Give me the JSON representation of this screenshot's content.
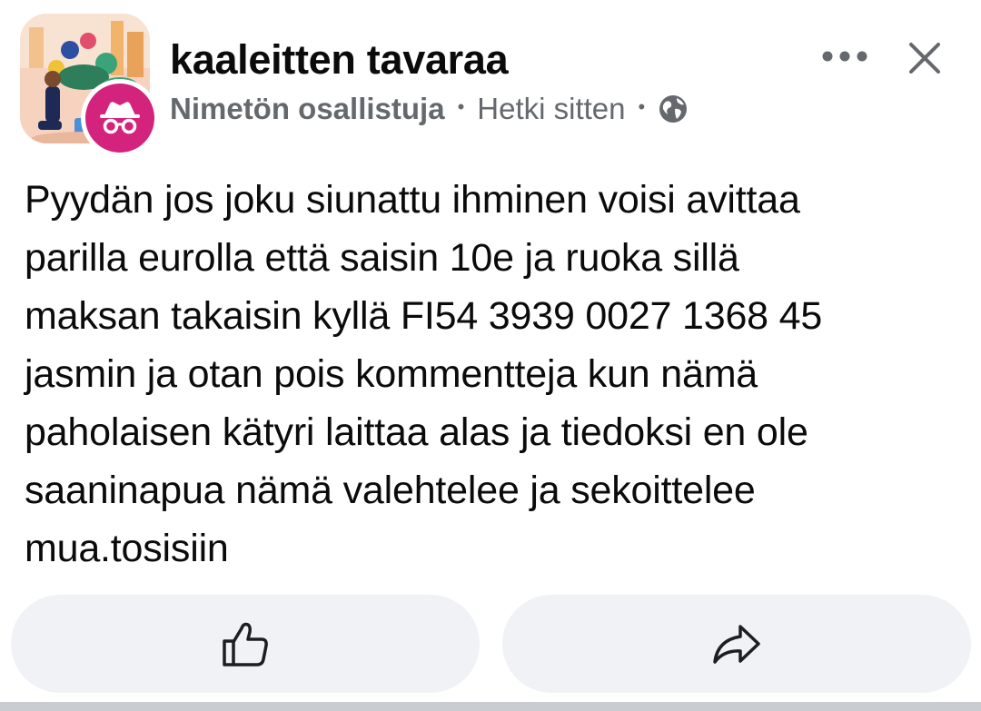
{
  "post": {
    "group_name": "kaaleitten tavaraa",
    "author": "Nimetön osallistuja",
    "separator": "•",
    "timestamp": "Hetki sitten",
    "privacy_icon": "globe-icon",
    "body": "Pyydän jos joku siunattu ihminen voisi avittaa\nparilla eurolla että saisin 10e ja ruoka sillä\nmaksan takaisin kyllä FI54 3939 0027 1368 45\njasmin ja otan pois kommentteja kun nämä\npaholaisen kätyri laittaa alas ja tiedoksi en ole\nsaaninapua nämä valehtelee ja sekoittelee\nmua.tosisiin"
  },
  "header": {
    "more_icon": "more-horizontal-icon",
    "close_icon": "close-icon"
  },
  "actions": {
    "like_icon": "thumbs-up-icon",
    "share_icon": "share-arrow-icon"
  },
  "colors": {
    "text": "#0b0b0b",
    "meta": "#65686c",
    "button_bg": "#f0f2f5",
    "anon_badge": "#d4237d"
  }
}
